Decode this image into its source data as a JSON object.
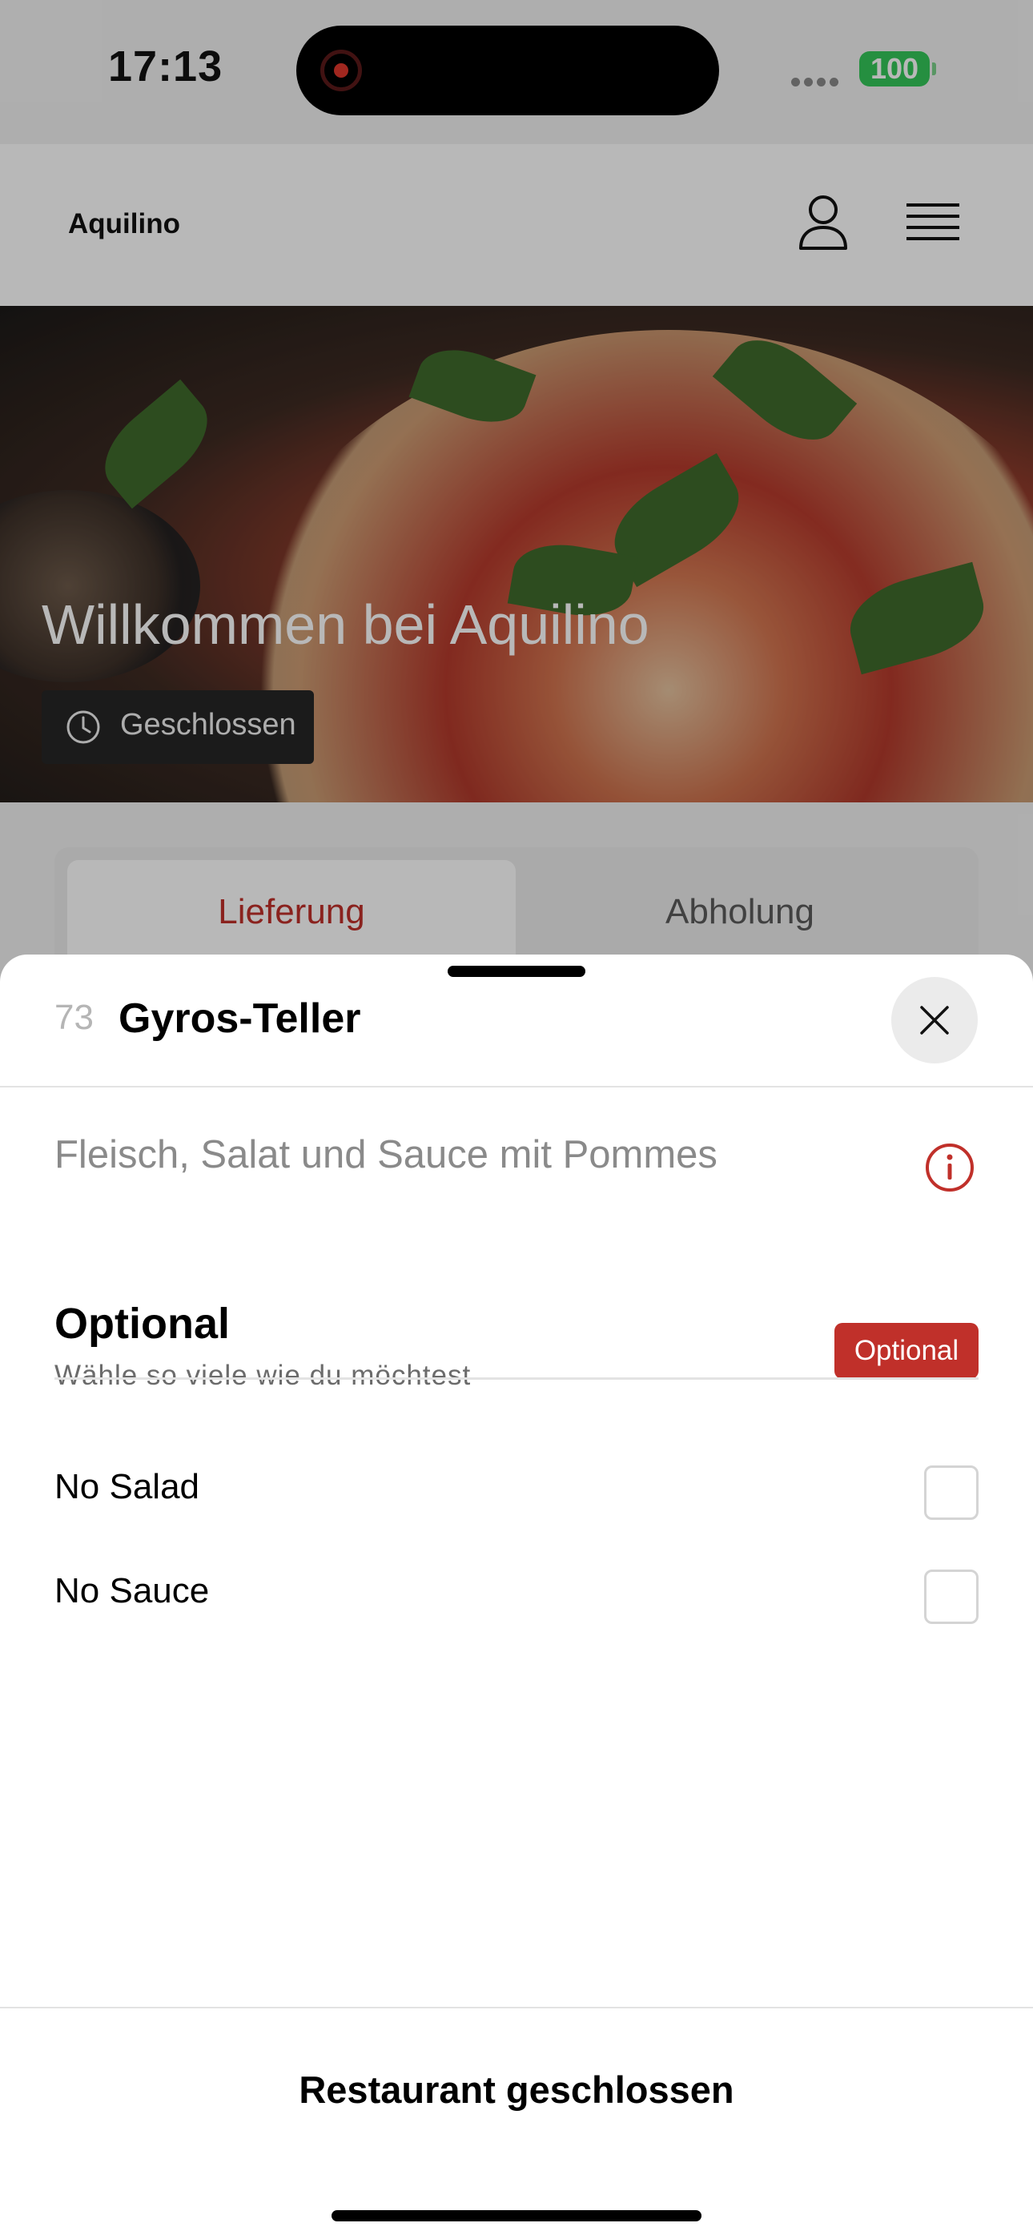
{
  "status_bar": {
    "time": "17:13",
    "battery": "100",
    "battery_color": "#34c759",
    "recording_color": "#e0362c"
  },
  "app_bar": {
    "brand": "Aquilino",
    "user_icon": "user-icon",
    "menu_icon": "menu-icon"
  },
  "hero": {
    "title": "Willkommen bei Aquilino",
    "status": "Geschlossen",
    "status_icon": "clock-icon"
  },
  "tabs": [
    {
      "label": "Lieferung",
      "active": true
    },
    {
      "label": "Abholung",
      "active": false
    }
  ],
  "item": {
    "number": "73",
    "title": "Gyros-Teller",
    "description": "Fleisch, Salat und Sauce mit Pommes"
  },
  "option_group": {
    "title": "Optional",
    "subtitle": "Wähle so viele wie du möchtest",
    "badge": "Optional",
    "options": [
      {
        "label": "No Salad",
        "checked": false
      },
      {
        "label": "No Sauce",
        "checked": false
      }
    ]
  },
  "footer": {
    "label": "Restaurant geschlossen"
  },
  "colors": {
    "accent": "#c0302a",
    "overlay": "rgba(0,0,0,0.28)"
  }
}
